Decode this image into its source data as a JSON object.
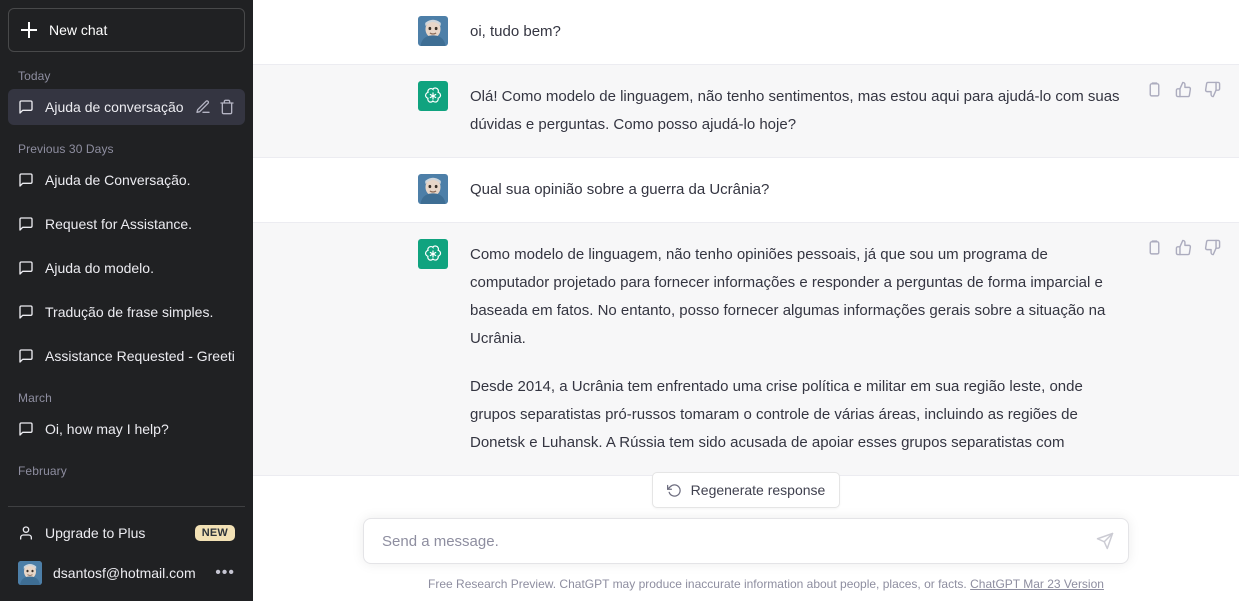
{
  "sidebar": {
    "new_chat_label": "New chat",
    "sections": [
      {
        "label": "Today",
        "items": [
          {
            "title": "Ajuda de conversação.",
            "active": true
          }
        ]
      },
      {
        "label": "Previous 30 Days",
        "items": [
          {
            "title": "Ajuda de Conversação.",
            "active": false
          },
          {
            "title": "Request for Assistance.",
            "active": false
          },
          {
            "title": "Ajuda do modelo.",
            "active": false
          },
          {
            "title": "Tradução de frase simples.",
            "active": false
          },
          {
            "title": "Assistance Requested - Greeti",
            "active": false
          }
        ]
      },
      {
        "label": "March",
        "items": [
          {
            "title": "Oi, how may I help?",
            "active": false
          }
        ]
      },
      {
        "label": "February",
        "items": []
      }
    ],
    "upgrade": {
      "label": "Upgrade to Plus",
      "badge": "NEW"
    },
    "account": {
      "email": "dsantosf@hotmail.com",
      "menu_dots": "•••"
    }
  },
  "thread": {
    "messages": [
      {
        "role": "user",
        "paragraphs": [
          "oi, tudo bem?"
        ]
      },
      {
        "role": "assistant",
        "paragraphs": [
          "Olá! Como modelo de linguagem, não tenho sentimentos, mas estou aqui para ajudá-lo com suas dúvidas e perguntas. Como posso ajudá-lo hoje?"
        ]
      },
      {
        "role": "user",
        "paragraphs": [
          "Qual sua opinião sobre a guerra da Ucrânia?"
        ]
      },
      {
        "role": "assistant",
        "paragraphs": [
          "Como modelo de linguagem, não tenho opiniões pessoais, já que sou um programa de computador projetado para fornecer informações e responder a perguntas de forma imparcial e baseada em fatos. No entanto, posso fornecer algumas informações gerais sobre a situação na Ucrânia.",
          "Desde 2014, a Ucrânia tem enfrentado uma crise política e militar em sua região leste, onde grupos separatistas pró-russos tomaram o controle de várias áreas, incluindo as regiões de Donetsk e Luhansk. A Rússia tem sido acusada de apoiar esses grupos separatistas com"
        ]
      }
    ],
    "action_labels": {
      "copy": "Copy",
      "thumbs_up": "Good response",
      "thumbs_down": "Bad response"
    }
  },
  "composer": {
    "regenerate_label": "Regenerate response",
    "input_value": "",
    "input_placeholder": "Send a message.",
    "footer_text": "Free Research Preview. ChatGPT may produce inaccurate information about people, places, or facts.",
    "footer_link": "ChatGPT Mar 23 Version"
  },
  "colors": {
    "sidebar_bg": "#202123",
    "active_item_bg": "#343541",
    "assistant_bg": "#f7f7f8",
    "brand_green": "#10a37f",
    "badge_yellow": "#f2e1b5"
  }
}
